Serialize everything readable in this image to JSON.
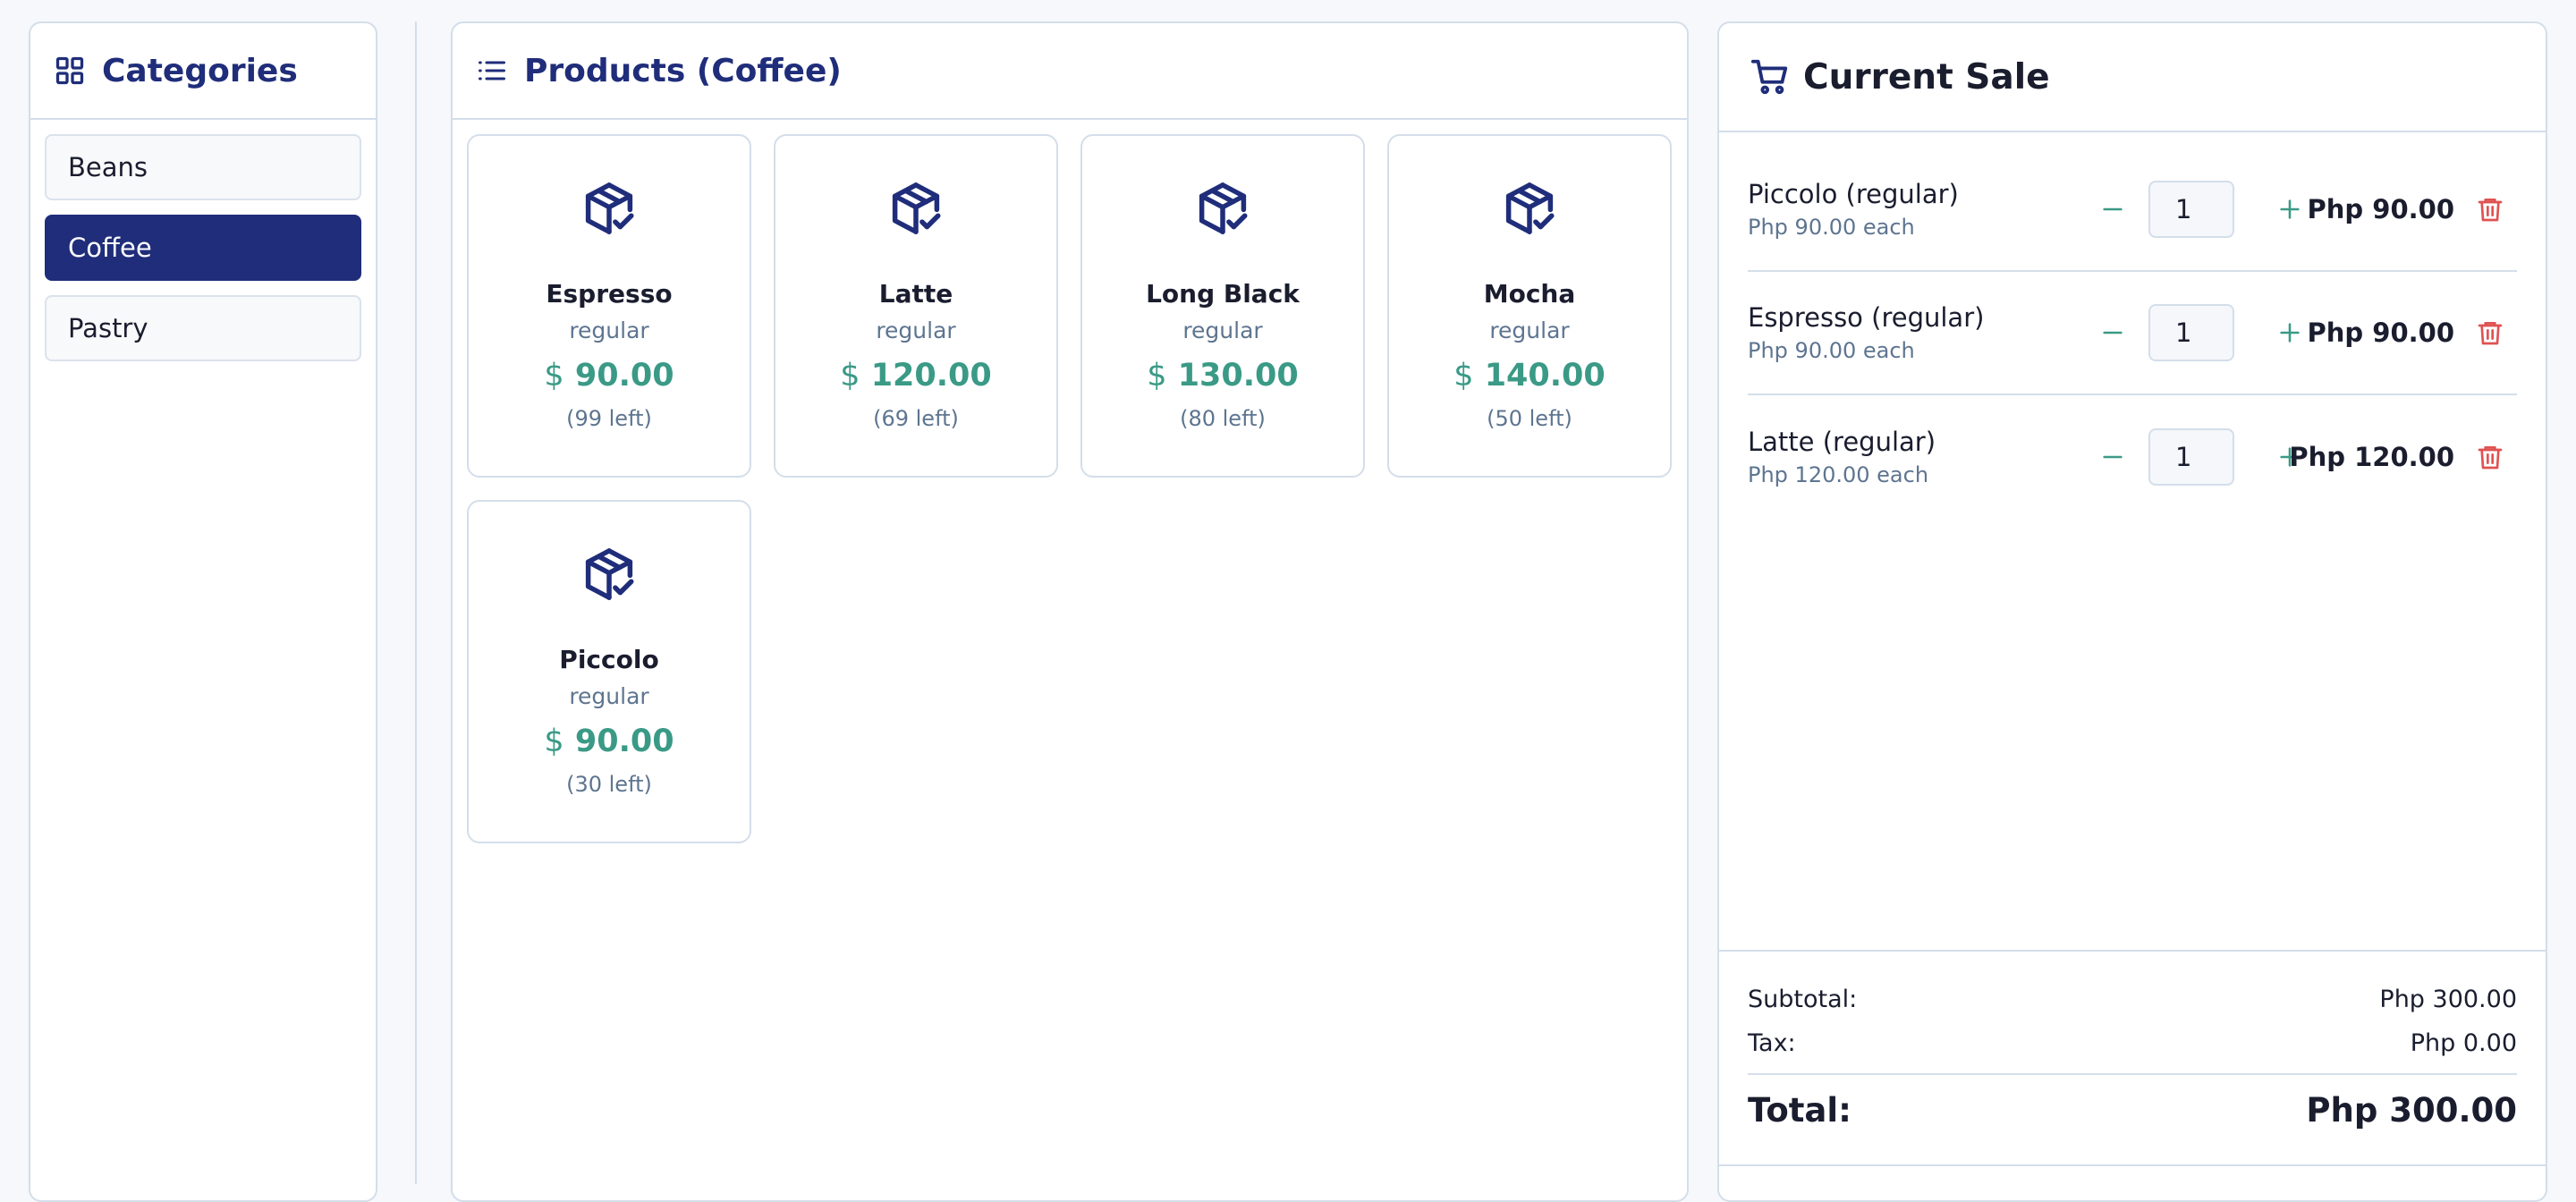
{
  "categories": {
    "title": "Categories",
    "items": [
      {
        "label": "Beans",
        "active": false
      },
      {
        "label": "Coffee",
        "active": true
      },
      {
        "label": "Pastry",
        "active": false
      }
    ]
  },
  "products": {
    "title": "Products (Coffee)",
    "items": [
      {
        "name": "Espresso",
        "variant": "regular",
        "currency": "$",
        "price": "90.00",
        "stock": "(99 left)"
      },
      {
        "name": "Latte",
        "variant": "regular",
        "currency": "$",
        "price": "120.00",
        "stock": "(69 left)"
      },
      {
        "name": "Long Black",
        "variant": "regular",
        "currency": "$",
        "price": "130.00",
        "stock": "(80 left)"
      },
      {
        "name": "Mocha",
        "variant": "regular",
        "currency": "$",
        "price": "140.00",
        "stock": "(50 left)"
      },
      {
        "name": "Piccolo",
        "variant": "regular",
        "currency": "$",
        "price": "90.00",
        "stock": "(30 left)"
      }
    ]
  },
  "sale": {
    "title": "Current Sale",
    "items": [
      {
        "name": "Piccolo (regular)",
        "each": "Php 90.00 each",
        "qty": "1",
        "total": "Php 90.00"
      },
      {
        "name": "Espresso (regular)",
        "each": "Php 90.00 each",
        "qty": "1",
        "total": "Php 90.00"
      },
      {
        "name": "Latte (regular)",
        "each": "Php 120.00 each",
        "qty": "1",
        "total": "Php 120.00"
      }
    ],
    "summary": {
      "subtotal_label": "Subtotal:",
      "subtotal_value": "Php 300.00",
      "tax_label": "Tax:",
      "tax_value": "Php 0.00",
      "total_label": "Total:",
      "total_value": "Php 300.00"
    }
  },
  "colors": {
    "brand": "#1f2d7a",
    "price": "#3a9a86",
    "delete": "#e05252",
    "border": "#d4deea"
  },
  "icons": {
    "categories": "grid-icon",
    "products": "list-icon",
    "product": "package-check-icon",
    "sale": "cart-icon",
    "minus": "minus-icon",
    "plus": "plus-icon",
    "delete": "trash-icon"
  }
}
